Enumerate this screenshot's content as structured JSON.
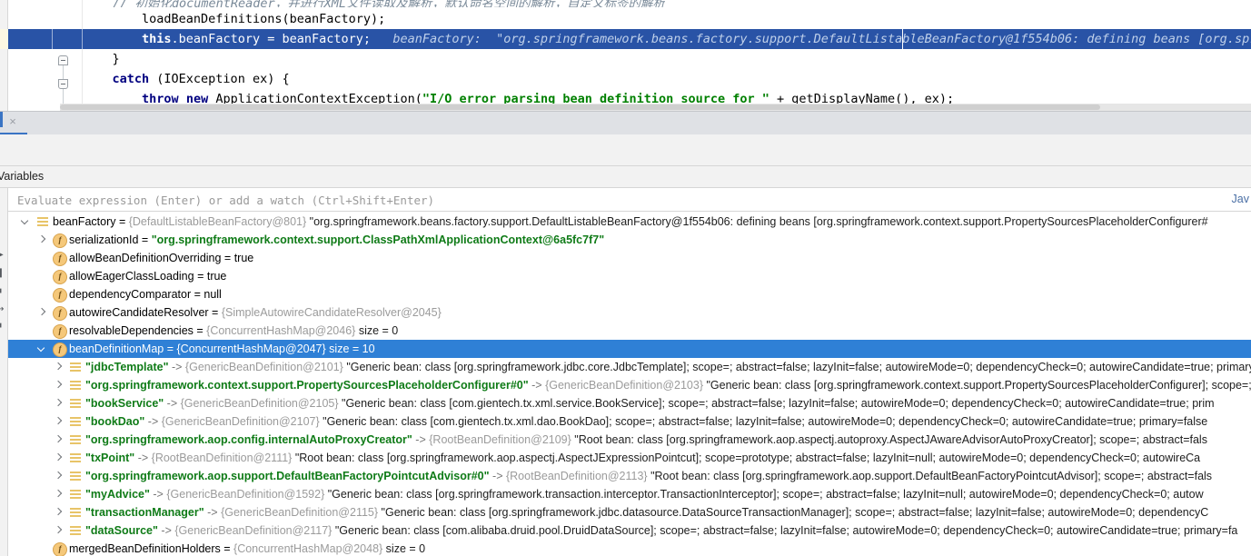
{
  "editor": {
    "chinese_comment": "// 初始化documentReader，并进行XML文件读取及解析，默认命名空间的解析，自定义标签的解析",
    "lines": [
      {
        "id": "line-load",
        "indent": "        ",
        "tokens": [
          {
            "t": "plain",
            "v": "loadBeanDefinitions(beanFactory);"
          }
        ]
      },
      {
        "id": "line-assign-highlighted",
        "indent": "        ",
        "highlighted": true,
        "tokens": [
          {
            "t": "kw",
            "v": "this"
          },
          {
            "t": "plain",
            "v": ".beanFactory = beanFactory;"
          }
        ],
        "inlay": "beanFactory:  \"org.springframework.beans.factory.support.DefaultListableBeanFactory@1f554b06: defining beans [org.springfram"
      },
      {
        "id": "line-close-brace",
        "indent": "    ",
        "tokens": [
          {
            "t": "plain",
            "v": "}"
          }
        ]
      },
      {
        "id": "line-catch",
        "indent": "    ",
        "tokens": [
          {
            "t": "kw",
            "v": "catch"
          },
          {
            "t": "plain",
            "v": " (IOException ex) {"
          }
        ]
      },
      {
        "id": "line-throw",
        "indent": "        ",
        "tokens": [
          {
            "t": "kw",
            "v": "throw"
          },
          {
            "t": "plain",
            "v": " "
          },
          {
            "t": "kw",
            "v": "new"
          },
          {
            "t": "plain",
            "v": " ApplicationContextException("
          },
          {
            "t": "str",
            "v": "\"I/O error parsing bean definition source for \""
          },
          {
            "t": "plain",
            "v": " + getDisplayName(), ex);"
          }
        ]
      }
    ]
  },
  "tabstrip": {
    "close_label": "×"
  },
  "leftbar": {
    "icons": [
      "resume-icon",
      "pause-icon",
      "stop-icon",
      "step-over-icon",
      "camera-icon"
    ]
  },
  "variables_panel": {
    "header_label": "Variables",
    "evaluate_placeholder": "Evaluate expression (Enter) or add a watch (Ctrl+Shift+Enter)",
    "evaluate_value": "",
    "language_label": "Jav"
  },
  "tree": [
    {
      "id": "row-beanFactory",
      "depth": 0,
      "arrow": "open",
      "icon": "entry",
      "selected": false,
      "name": "beanFactory",
      "name_style": "plain",
      "eq": " = ",
      "type": "{DefaultListableBeanFactory@801}",
      "desc": "  \"org.springframework.beans.factory.support.DefaultListableBeanFactory@1f554b06: defining beans [org.springframework.context.support.PropertySourcesPlaceholderConfigurer#"
    },
    {
      "id": "row-serializationId",
      "depth": 1,
      "arrow": "closed",
      "icon": "field",
      "selected": false,
      "name": "serializationId",
      "name_style": "plain",
      "eq": " = ",
      "str": "\"org.springframework.context.support.ClassPathXmlApplicationContext@6a5fc7f7\""
    },
    {
      "id": "row-allowBeanDefinitionOverriding",
      "depth": 1,
      "arrow": "none",
      "icon": "field",
      "selected": false,
      "name": "allowBeanDefinitionOverriding",
      "name_style": "plain",
      "eq": " = ",
      "value": "true"
    },
    {
      "id": "row-allowEagerClassLoading",
      "depth": 1,
      "arrow": "none",
      "icon": "field",
      "selected": false,
      "name": "allowEagerClassLoading",
      "name_style": "plain",
      "eq": " = ",
      "value": "true"
    },
    {
      "id": "row-dependencyComparator",
      "depth": 1,
      "arrow": "none",
      "icon": "field",
      "selected": false,
      "name": "dependencyComparator",
      "name_style": "plain",
      "eq": " = ",
      "value": "null"
    },
    {
      "id": "row-autowireCandidateResolver",
      "depth": 1,
      "arrow": "closed",
      "icon": "field",
      "selected": false,
      "name": "autowireCandidateResolver",
      "name_style": "plain",
      "eq": " = ",
      "type": "{SimpleAutowireCandidateResolver@2045}"
    },
    {
      "id": "row-resolvableDependencies",
      "depth": 1,
      "arrow": "none",
      "icon": "field",
      "selected": false,
      "name": "resolvableDependencies",
      "name_style": "plain",
      "eq": " = ",
      "type": "{ConcurrentHashMap@2046}",
      "desc": "  size = 0"
    },
    {
      "id": "row-beanDefinitionMap",
      "depth": 1,
      "arrow": "open",
      "icon": "field",
      "selected": true,
      "name": "beanDefinitionMap",
      "name_style": "plain",
      "eq": " = ",
      "type": "{ConcurrentHashMap@2047}",
      "desc": "  size = 10"
    },
    {
      "id": "row-jdbcTemplate",
      "depth": 2,
      "arrow": "closed",
      "icon": "entry",
      "selected": false,
      "name": "\"jdbcTemplate\"",
      "name_style": "bold",
      "maparrow": " -> ",
      "type": "{GenericBeanDefinition@2101}",
      "desc": " \"Generic bean: class [org.springframework.jdbc.core.JdbcTemplate]; scope=; abstract=false; lazyInit=false; autowireMode=0; dependencyCheck=0; autowireCandidate=true; primary=false"
    },
    {
      "id": "row-propertySourcesPlaceholderConfigurer",
      "depth": 2,
      "arrow": "closed",
      "icon": "entry",
      "selected": false,
      "name": "\"org.springframework.context.support.PropertySourcesPlaceholderConfigurer#0\"",
      "name_style": "bold",
      "maparrow": " -> ",
      "type": "{GenericBeanDefinition@2103}",
      "desc": " \"Generic bean: class [org.springframework.context.support.PropertySourcesPlaceholderConfigurer]; scope=; abstract=false; lazyInit=false"
    },
    {
      "id": "row-bookService",
      "depth": 2,
      "arrow": "closed",
      "icon": "entry",
      "selected": false,
      "name": "\"bookService\"",
      "name_style": "bold",
      "maparrow": " -> ",
      "type": "{GenericBeanDefinition@2105}",
      "desc": " \"Generic bean: class [com.gientech.tx.xml.service.BookService]; scope=; abstract=false; lazyInit=false; autowireMode=0; dependencyCheck=0; autowireCandidate=true; prim"
    },
    {
      "id": "row-bookDao",
      "depth": 2,
      "arrow": "closed",
      "icon": "entry",
      "selected": false,
      "name": "\"bookDao\"",
      "name_style": "bold",
      "maparrow": " -> ",
      "type": "{GenericBeanDefinition@2107}",
      "desc": " \"Generic bean: class [com.gientech.tx.xml.dao.BookDao]; scope=; abstract=false; lazyInit=false; autowireMode=0; dependencyCheck=0; autowireCandidate=true; primary=false"
    },
    {
      "id": "row-internalAutoProxyCreator",
      "depth": 2,
      "arrow": "closed",
      "icon": "entry",
      "selected": false,
      "name": "\"org.springframework.aop.config.internalAutoProxyCreator\"",
      "name_style": "bold",
      "maparrow": " -> ",
      "type": "{RootBeanDefinition@2109}",
      "desc": " \"Root bean: class [org.springframework.aop.aspectj.autoproxy.AspectJAwareAdvisorAutoProxyCreator]; scope=; abstract=fals"
    },
    {
      "id": "row-txPoint",
      "depth": 2,
      "arrow": "closed",
      "icon": "entry",
      "selected": false,
      "name": "\"txPoint\"",
      "name_style": "bold",
      "maparrow": " -> ",
      "type": "{RootBeanDefinition@2111}",
      "desc": " \"Root bean: class [org.springframework.aop.aspectj.AspectJExpressionPointcut]; scope=prototype; abstract=false; lazyInit=null; autowireMode=0; dependencyCheck=0; autowireCa"
    },
    {
      "id": "row-defaultBeanFactoryPointcutAdvisor",
      "depth": 2,
      "arrow": "closed",
      "icon": "entry",
      "selected": false,
      "name": "\"org.springframework.aop.support.DefaultBeanFactoryPointcutAdvisor#0\"",
      "name_style": "bold",
      "maparrow": " -> ",
      "type": "{RootBeanDefinition@2113}",
      "desc": " \"Root bean: class [org.springframework.aop.support.DefaultBeanFactoryPointcutAdvisor]; scope=; abstract=fals"
    },
    {
      "id": "row-myAdvice",
      "depth": 2,
      "arrow": "closed",
      "icon": "entry",
      "selected": false,
      "name": "\"myAdvice\"",
      "name_style": "bold",
      "maparrow": " -> ",
      "type": "{GenericBeanDefinition@1592}",
      "desc": " \"Generic bean: class [org.springframework.transaction.interceptor.TransactionInterceptor]; scope=; abstract=false; lazyInit=null; autowireMode=0; dependencyCheck=0; autow"
    },
    {
      "id": "row-transactionManager",
      "depth": 2,
      "arrow": "closed",
      "icon": "entry",
      "selected": false,
      "name": "\"transactionManager\"",
      "name_style": "bold",
      "maparrow": " -> ",
      "type": "{GenericBeanDefinition@2115}",
      "desc": " \"Generic bean: class [org.springframework.jdbc.datasource.DataSourceTransactionManager]; scope=; abstract=false; lazyInit=false; autowireMode=0; dependencyC"
    },
    {
      "id": "row-dataSource",
      "depth": 2,
      "arrow": "closed",
      "icon": "entry",
      "selected": false,
      "name": "\"dataSource\"",
      "name_style": "bold",
      "maparrow": " -> ",
      "type": "{GenericBeanDefinition@2117}",
      "desc": " \"Generic bean: class [com.alibaba.druid.pool.DruidDataSource]; scope=; abstract=false; lazyInit=false; autowireMode=0; dependencyCheck=0; autowireCandidate=true; primary=fa"
    },
    {
      "id": "row-mergedBeanDefinitionHolders",
      "depth": 1,
      "arrow": "none",
      "icon": "field",
      "selected": false,
      "name": "mergedBeanDefinitionHolders",
      "name_style": "plain",
      "eq": " = ",
      "type": "{ConcurrentHashMap@2048}",
      "desc": "  size = 0"
    }
  ]
}
